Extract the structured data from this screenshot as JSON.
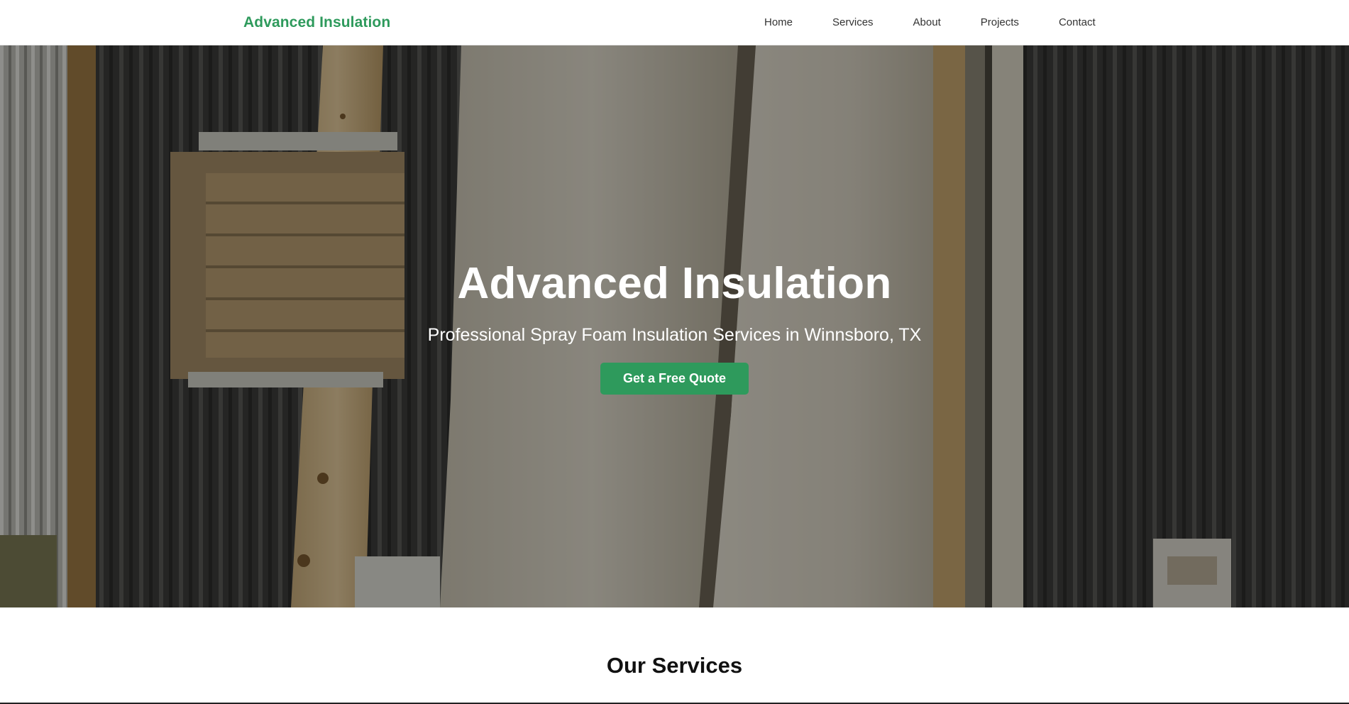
{
  "header": {
    "logo": "Advanced Insulation",
    "nav": [
      {
        "label": "Home"
      },
      {
        "label": "Services"
      },
      {
        "label": "About"
      },
      {
        "label": "Projects"
      },
      {
        "label": "Contact"
      }
    ]
  },
  "hero": {
    "title": "Advanced Insulation",
    "subtitle": "Professional Spray Foam Insulation Services in Winnsboro, TX",
    "cta_label": "Get a Free Quote",
    "background_image": "spray-foam-insulated-wall-photo"
  },
  "services": {
    "title": "Our Services"
  },
  "colors": {
    "brand_green": "#2e9a5c",
    "nav_text": "#333333",
    "hero_text": "#ffffff"
  }
}
